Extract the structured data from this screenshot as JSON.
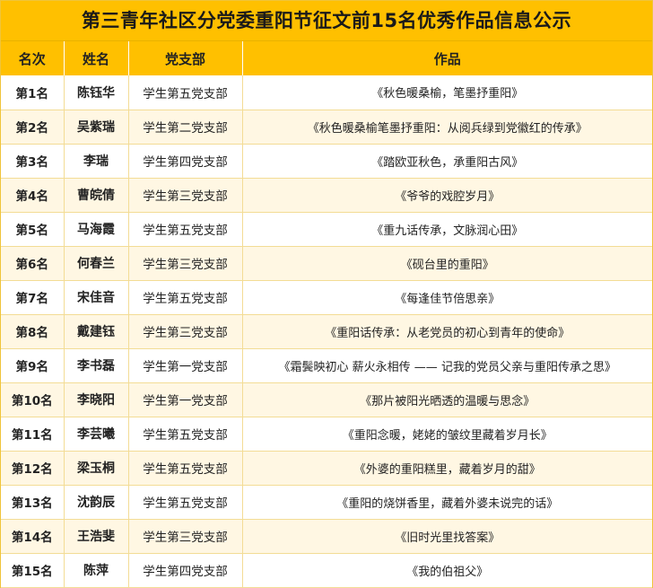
{
  "title": "第三青年社区分党委重阳节征文前15名优秀作品信息公示",
  "headers": {
    "rank": "名次",
    "name": "姓名",
    "branch": "党支部",
    "work": "作品"
  },
  "rows": [
    {
      "rank": "第1名",
      "name": "陈钰华",
      "branch": "学生第五党支部",
      "work": "《秋色暖桑榆，笔墨抒重阳》"
    },
    {
      "rank": "第2名",
      "name": "吴紫瑞",
      "branch": "学生第二党支部",
      "work": "《秋色暖桑榆笔墨抒重阳：从阅兵绿到党徽红的传承》"
    },
    {
      "rank": "第3名",
      "name": "李瑞",
      "branch": "学生第四党支部",
      "work": "《踏欧亚秋色，承重阳古风》"
    },
    {
      "rank": "第4名",
      "name": "曹皖倩",
      "branch": "学生第三党支部",
      "work": "《爷爷的戏腔岁月》"
    },
    {
      "rank": "第5名",
      "name": "马海霞",
      "branch": "学生第五党支部",
      "work": "《重九话传承，文脉润心田》"
    },
    {
      "rank": "第6名",
      "name": "何春兰",
      "branch": "学生第三党支部",
      "work": "《砚台里的重阳》"
    },
    {
      "rank": "第7名",
      "name": "宋佳音",
      "branch": "学生第五党支部",
      "work": "《每逢佳节倍思亲》"
    },
    {
      "rank": "第8名",
      "name": "戴建钰",
      "branch": "学生第三党支部",
      "work": "《重阳话传承：从老党员的初心到青年的使命》"
    },
    {
      "rank": "第9名",
      "name": "李书磊",
      "branch": "学生第一党支部",
      "work": "《霜鬓映初心 薪火永相传 —— 记我的党员父亲与重阳传承之思》"
    },
    {
      "rank": "第10名",
      "name": "李晓阳",
      "branch": "学生第一党支部",
      "work": "《那片被阳光晒透的温暖与思念》"
    },
    {
      "rank": "第11名",
      "name": "李芸曦",
      "branch": "学生第五党支部",
      "work": "《重阳念暖，姥姥的皱纹里藏着岁月长》"
    },
    {
      "rank": "第12名",
      "name": "梁玉桐",
      "branch": "学生第五党支部",
      "work": "《外婆的重阳糕里，藏着岁月的甜》"
    },
    {
      "rank": "第13名",
      "name": "沈韵辰",
      "branch": "学生第五党支部",
      "work": "《重阳的烧饼香里，藏着外婆未说完的话》"
    },
    {
      "rank": "第14名",
      "name": "王浩斐",
      "branch": "学生第三党支部",
      "work": "《旧时光里找答案》"
    },
    {
      "rank": "第15名",
      "name": "陈萍",
      "branch": "学生第四党支部",
      "work": "《我的伯祖父》"
    }
  ]
}
